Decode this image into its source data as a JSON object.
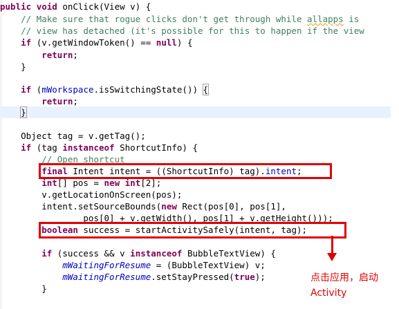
{
  "code": {
    "lines": [
      {
        "kind": "sig",
        "t1": "public",
        "t2": " ",
        "t3": "void",
        "t4": " onClick(View v) {"
      },
      {
        "kind": "comment",
        "text": "    // Make sure that rogue clicks don't get through while ",
        "squiggle": "allapps",
        "tail": " is"
      },
      {
        "kind": "comment2",
        "text": "    // view has detached (it's possible for this to happen if the view"
      },
      {
        "kind": "if1",
        "a": "    ",
        "b": "if",
        "c": " (v.getWindowToken() == ",
        "d": "null",
        "e": ") {"
      },
      {
        "kind": "ret",
        "a": "        ",
        "b": "return",
        "c": ";"
      },
      {
        "kind": "plain",
        "text": "    }"
      },
      {
        "kind": "blank"
      },
      {
        "kind": "if2",
        "a": "    ",
        "b": "if",
        "c": " (",
        "d": "mWorkspace",
        "e": ".isSwitchingState()) ",
        "f": "{"
      },
      {
        "kind": "ret",
        "a": "        ",
        "b": "return",
        "c": ";"
      },
      {
        "kind": "close-hl",
        "a": "    ",
        "b": "}"
      },
      {
        "kind": "blank"
      },
      {
        "kind": "plain",
        "text": "    Object tag = v.getTag();"
      },
      {
        "kind": "if3",
        "a": "    ",
        "b": "if",
        "c": " (tag ",
        "d": "instanceof",
        "e": " ShortcutInfo) {"
      },
      {
        "kind": "comment3",
        "text": "        // Open shortcut"
      },
      {
        "kind": "final",
        "a": "        ",
        "b": "final",
        "c": " Intent intent = ((ShortcutInfo) tag).",
        "d": "intent",
        "e": ";"
      },
      {
        "kind": "int",
        "a": "        ",
        "b": "int",
        "c": "[] pos = ",
        "d": "new",
        "e": " ",
        "f": "int",
        "g": "[2];"
      },
      {
        "kind": "plain",
        "text": "        v.getLocationOnScreen(pos);"
      },
      {
        "kind": "setsrc",
        "a": "        intent.setSourceBounds(",
        "b": "new",
        "c": " Rect(pos[0], pos[1],"
      },
      {
        "kind": "plain",
        "text": "                pos[0] + v.getWidth(), pos[1] + v.getHeight()));"
      },
      {
        "kind": "bool",
        "a": "        ",
        "b": "boolean",
        "c": " success = startActivitySafely(intent, tag);"
      },
      {
        "kind": "blank"
      },
      {
        "kind": "if4",
        "a": "        ",
        "b": "if",
        "c": " (success && v ",
        "d": "instanceof",
        "e": " BubbleTextView) {"
      },
      {
        "kind": "mwait1",
        "a": "            ",
        "b": "mWaitingForResume",
        "c": " = (BubbleTextView) v;"
      },
      {
        "kind": "mwait2",
        "a": "            ",
        "b": "mWaitingForResume",
        "c": ".setStayPressed(",
        "d": "true",
        "e": ");"
      },
      {
        "kind": "plain",
        "text": "        }"
      }
    ]
  },
  "annotation": {
    "line1": "点击应用，启动",
    "line2": "Activity",
    "color": "#e00000"
  },
  "colors": {
    "keyword": "#7f0055",
    "comment": "#3f7f5f",
    "field": "#0000c0",
    "current_line": "#e8f2fe"
  }
}
